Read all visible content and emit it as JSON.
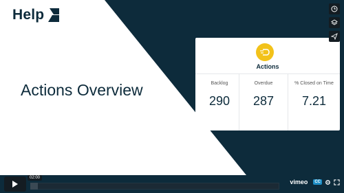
{
  "brand": {
    "name": "Help"
  },
  "slide": {
    "headline": "Actions Overview"
  },
  "card": {
    "title": "Actions",
    "columns": [
      {
        "label": "Backlog",
        "value": "290"
      },
      {
        "label": "Overdue",
        "value": "287"
      },
      {
        "label": "% Closed on Time",
        "value": "7.21"
      }
    ]
  },
  "player": {
    "time": "02:00",
    "progress_fraction": 0.03,
    "watermark": "vimeo",
    "cc_label": "CC",
    "side_buttons": [
      "clock-icon",
      "layers-icon",
      "share-icon"
    ]
  },
  "colors": {
    "navy": "#0d2b3b",
    "accent": "#f2c21a",
    "cc": "#1f8fc6"
  }
}
